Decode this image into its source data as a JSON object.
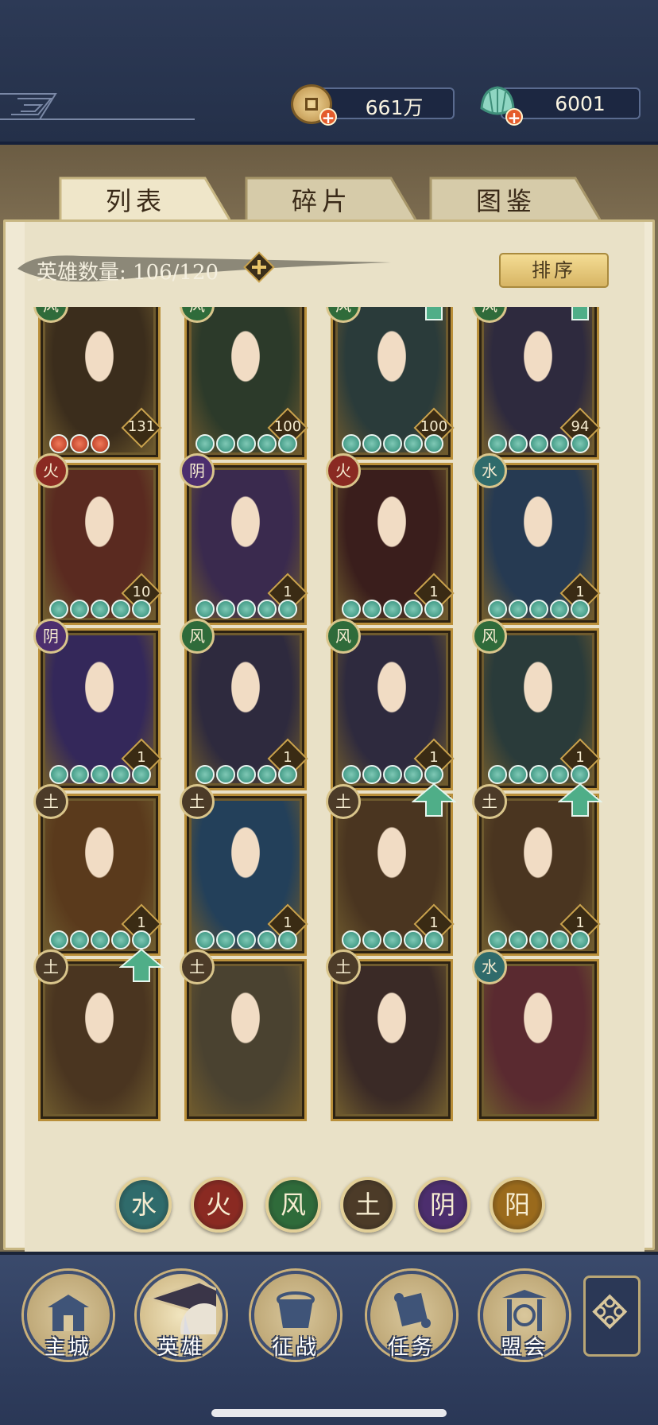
{
  "resources": {
    "coins": {
      "icon": "copper-coin-icon",
      "value": "661万"
    },
    "jade": {
      "icon": "jade-shell-icon",
      "value": "6001"
    }
  },
  "tabs": [
    {
      "label": "列表",
      "active": true
    },
    {
      "label": "碎片",
      "active": false
    },
    {
      "label": "图鉴",
      "active": false
    }
  ],
  "hero_count": {
    "label": "英雄数量: 106/120"
  },
  "sort_label": "排序",
  "element_colors": {
    "wind": "#2f6b6b",
    "fire": "#8a2a22",
    "wood": "#2f6b3a",
    "earth": "#4c3b28",
    "yin": "#4c2e6e",
    "yang": "#9a6a1c"
  },
  "element_glyphs": {
    "wind": "水",
    "fire": "火",
    "wood": "风",
    "earth": "土",
    "yin": "阴",
    "yang": "阳"
  },
  "heroes": [
    {
      "element": "wood",
      "level": "131",
      "stars": 3,
      "star_color": "red",
      "upgrade": false,
      "art": "#3b2d1c"
    },
    {
      "element": "wood",
      "level": "100",
      "stars": 5,
      "star_color": "jade",
      "upgrade": false,
      "art": "#2c3a2a"
    },
    {
      "element": "wood",
      "level": "100",
      "stars": 5,
      "star_color": "jade",
      "upgrade": true,
      "art": "#2a3b3a"
    },
    {
      "element": "wood",
      "level": "94",
      "stars": 5,
      "star_color": "jade",
      "upgrade": true,
      "art": "#2e2a3e"
    },
    {
      "element": "fire",
      "level": "10",
      "stars": 5,
      "star_color": "jade",
      "upgrade": false,
      "art": "#5a2a20"
    },
    {
      "element": "yin",
      "level": "1",
      "stars": 5,
      "star_color": "jade",
      "upgrade": false,
      "art": "#3a2a4e"
    },
    {
      "element": "fire",
      "level": "1",
      "stars": 5,
      "star_color": "jade",
      "upgrade": false,
      "art": "#3a1e1c"
    },
    {
      "element": "wind",
      "level": "1",
      "stars": 5,
      "star_color": "jade",
      "upgrade": false,
      "art": "#263a52"
    },
    {
      "element": "yin",
      "level": "1",
      "stars": 5,
      "star_color": "jade",
      "upgrade": false,
      "art": "#34285a"
    },
    {
      "element": "wood",
      "level": "1",
      "stars": 5,
      "star_color": "jade",
      "upgrade": false,
      "art": "#2e2a3e"
    },
    {
      "element": "wood",
      "level": "1",
      "stars": 5,
      "star_color": "jade",
      "upgrade": false,
      "art": "#2e2a3e"
    },
    {
      "element": "wood",
      "level": "1",
      "stars": 5,
      "star_color": "jade",
      "upgrade": false,
      "art": "#2a3b3a"
    },
    {
      "element": "earth",
      "level": "1",
      "stars": 5,
      "star_color": "jade",
      "upgrade": false,
      "art": "#5a3a1c"
    },
    {
      "element": "earth",
      "level": "1",
      "stars": 5,
      "star_color": "jade",
      "upgrade": false,
      "art": "#23405a"
    },
    {
      "element": "earth",
      "level": "1",
      "stars": 5,
      "star_color": "jade",
      "upgrade": true,
      "art": "#4a3520"
    },
    {
      "element": "earth",
      "level": "1",
      "stars": 5,
      "star_color": "jade",
      "upgrade": true,
      "art": "#4a3520"
    },
    {
      "element": "earth",
      "level": "",
      "stars": 0,
      "star_color": "jade",
      "upgrade": true,
      "art": "#4a3520"
    },
    {
      "element": "earth",
      "level": "",
      "stars": 0,
      "star_color": "jade",
      "upgrade": false,
      "art": "#4a4230"
    },
    {
      "element": "earth",
      "level": "",
      "stars": 0,
      "star_color": "jade",
      "upgrade": false,
      "art": "#3a2a26"
    },
    {
      "element": "wind",
      "level": "",
      "stars": 0,
      "star_color": "jade",
      "upgrade": false,
      "art": "#5a2a30"
    }
  ],
  "element_filters": [
    "wind",
    "fire",
    "wood",
    "earth",
    "yin",
    "yang"
  ],
  "nav": [
    {
      "label": "主城",
      "icon": "city-gate-icon"
    },
    {
      "label": "英雄",
      "icon": "hero-portrait-icon",
      "active": true
    },
    {
      "label": "征战",
      "icon": "battle-drum-icon"
    },
    {
      "label": "任务",
      "icon": "scroll-icon"
    },
    {
      "label": "盟会",
      "icon": "alliance-gate-icon"
    }
  ],
  "nav_more_icon": "lattice-menu-icon"
}
